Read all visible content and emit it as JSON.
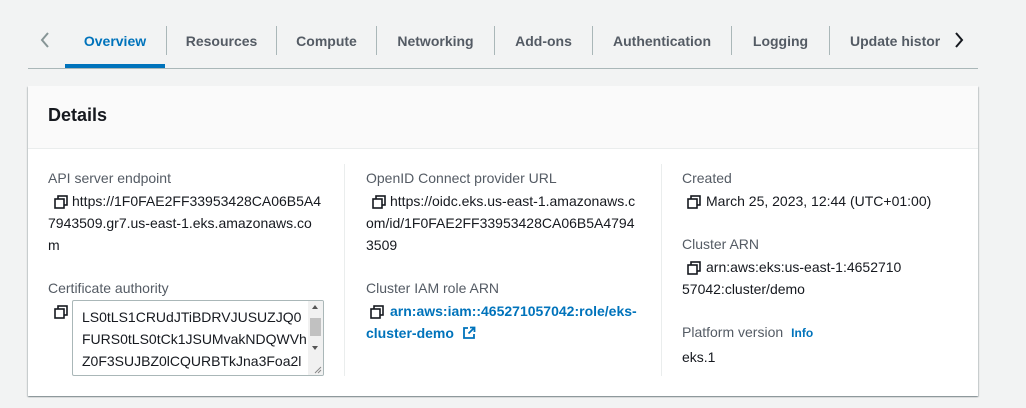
{
  "tabs": {
    "items": [
      {
        "label": "Overview",
        "active": true
      },
      {
        "label": "Resources"
      },
      {
        "label": "Compute"
      },
      {
        "label": "Networking"
      },
      {
        "label": "Add-ons"
      },
      {
        "label": "Authentication"
      },
      {
        "label": "Logging"
      },
      {
        "label": "Update histor"
      }
    ]
  },
  "details": {
    "title": "Details",
    "api_server_endpoint": {
      "label": "API server endpoint",
      "value": "https://1F0FAE2FF33953428CA06B5A47943509.gr7.us-east-1.eks.amazonaws.com"
    },
    "certificate_authority": {
      "label": "Certificate authority",
      "value": "LS0tLS1CRUdJTiBDRVJUSUZJQ0FURS0tLS0tCk1JSUMvakNDQWVhZ0F3SUJBZ0lCQURBTkJna3Foa2l"
    },
    "oidc_provider_url": {
      "label": "OpenID Connect provider URL",
      "value": "https://oidc.eks.us-east-1.amazonaws.com/id/1F0FAE2FF33953428CA06B5A47943509"
    },
    "cluster_iam_role_arn": {
      "label": "Cluster IAM role ARN",
      "value": "arn:aws:iam::465271057042:role/eks-cluster-demo"
    },
    "created": {
      "label": "Created",
      "value": "March 25, 2023, 12:44 (UTC+01:00)"
    },
    "cluster_arn": {
      "label": "Cluster ARN",
      "value": "arn:aws:eks:us-east-1:465271057042:cluster/demo"
    },
    "platform_version": {
      "label": "Platform version",
      "info": "Info",
      "value": "eks.1"
    }
  },
  "colors": {
    "accent": "#0073bb",
    "text": "#16191f",
    "label": "#545b64",
    "background": "#f2f3f3"
  },
  "icons": [
    "chevron-left-icon",
    "chevron-right-icon",
    "copy-icon",
    "external-link-icon"
  ]
}
